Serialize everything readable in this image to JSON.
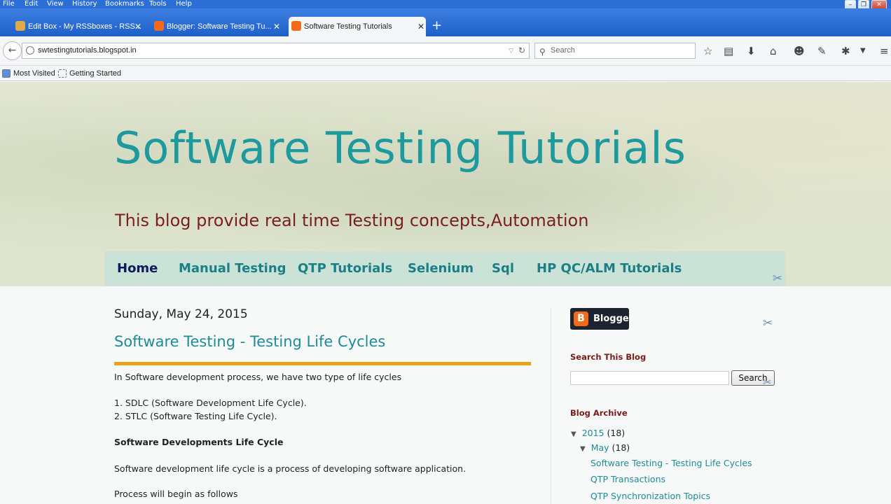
{
  "menubar": {
    "items": [
      "File",
      "Edit",
      "View",
      "History",
      "Bookmarks",
      "Tools",
      "Help"
    ]
  },
  "tabs": [
    {
      "label": "Edit Box - My RSSboxes - RSS..."
    },
    {
      "label": "Blogger: Software Testing Tu..."
    },
    {
      "label": "Software Testing Tutorials"
    }
  ],
  "urlbar": {
    "url": "swtestingtutorials.blogspot.in"
  },
  "searchbar": {
    "placeholder": "Search"
  },
  "bookmarks": [
    "Most Visited",
    "Getting Started"
  ],
  "blog": {
    "title": "Software Testing Tutorials",
    "description": "This blog provide real time Testing concepts,Automation",
    "nav": [
      "Home",
      "Manual Testing",
      "QTP Tutorials",
      "Selenium",
      "Sql",
      "HP QC/ALM Tutorials"
    ]
  },
  "post": {
    "date": "Sunday, May 24, 2015",
    "title": "Software Testing - Testing Life Cycles",
    "lines": [
      "In Software development process,  we have two type of life cycles",
      "1. SDLC (Software Development Life Cycle).",
      "2. STLC (Software Testing Life Cycle).",
      "Software Developments Life Cycle",
      "Software development life cycle  is a process of developing software application.",
      "Process will begin as follows"
    ]
  },
  "sidebar": {
    "badge": "Blogger",
    "badge_letter": "B",
    "search_heading": "Search This Blog",
    "search_button": "Search",
    "archive_heading": "Blog Archive",
    "archive": {
      "year": "2015",
      "year_count": "(18)",
      "month": "May",
      "month_count": "(18)",
      "posts": [
        "Software Testing - Testing Life Cycles",
        "QTP Transactions",
        "QTP Synchronization Topics"
      ]
    }
  },
  "colors": {
    "title": "#1e9a9e",
    "description": "#7a1f1f",
    "nav_current": "#101a5c",
    "post_rule": "#e8a21a",
    "blogger_orange": "#f26a1b"
  }
}
